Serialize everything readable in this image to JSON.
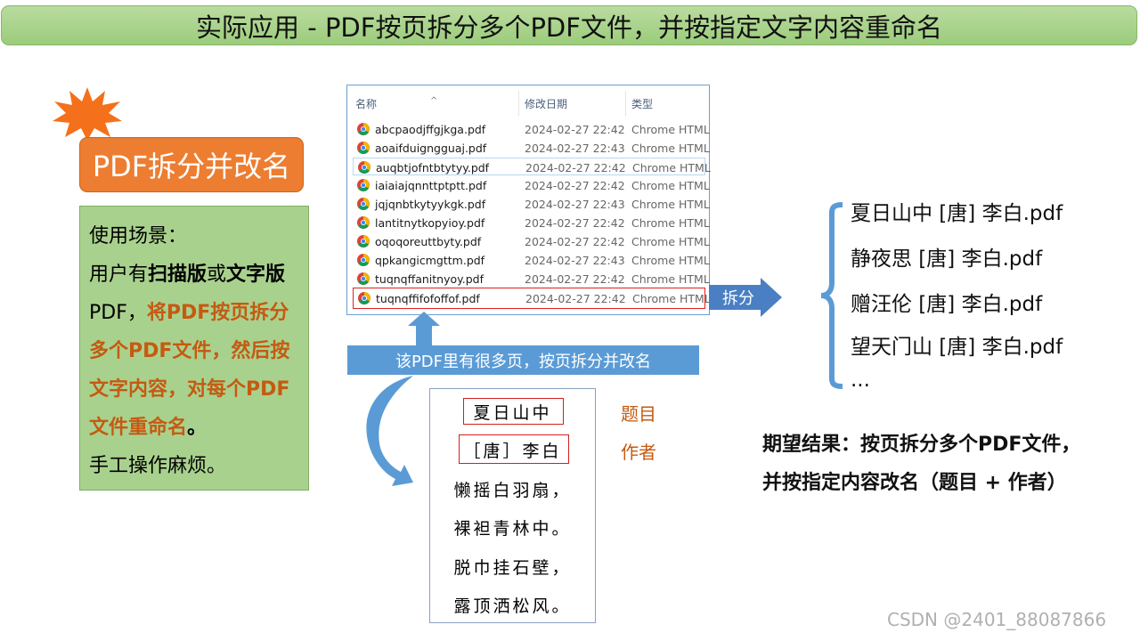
{
  "title": "实际应用 - PDF按页拆分多个PDF文件，并按指定文字内容重命名",
  "badge": "PDF拆分并改名",
  "scenario": {
    "p1": "使用场景：",
    "p2a": "用户有",
    "p2b": "扫描版",
    "p2c": "或",
    "p2d": "文字版",
    "p2e": "PDF，",
    "p2f": "将PDF按页拆分多个PDF文件，然后按文字内容，对每个PDF文件重命名",
    "p2g": "。",
    "p3": "手工操作麻烦。"
  },
  "explorer": {
    "col_name": "名称",
    "col_date": "修改日期",
    "col_type": "类型",
    "sort_icon": "sort-up-caret",
    "files": [
      {
        "name": "abcpaodjffgjkga.pdf",
        "date": "2024-02-27 22:42",
        "type": "Chrome HTML"
      },
      {
        "name": "aoaifduigngguaj.pdf",
        "date": "2024-02-27 22:43",
        "type": "Chrome HTML"
      },
      {
        "name": "auqbtjofntbtytyy.pdf",
        "date": "2024-02-27 22:42",
        "type": "Chrome HTML"
      },
      {
        "name": "iaiaiajqnnttptptt.pdf",
        "date": "2024-02-27 22:42",
        "type": "Chrome HTML"
      },
      {
        "name": "jqjqnbtkytyykgk.pdf",
        "date": "2024-02-27 22:43",
        "type": "Chrome HTML"
      },
      {
        "name": "lantitnytkopyioy.pdf",
        "date": "2024-02-27 22:42",
        "type": "Chrome HTML"
      },
      {
        "name": "oqoqoreuttbyty.pdf",
        "date": "2024-02-27 22:42",
        "type": "Chrome HTML"
      },
      {
        "name": "qpkangicmgttm.pdf",
        "date": "2024-02-27 22:43",
        "type": "Chrome HTML"
      },
      {
        "name": "tuqnqffanitnyoy.pdf",
        "date": "2024-02-27 22:42",
        "type": "Chrome HTML"
      },
      {
        "name": "tuqnqffifofoffof.pdf",
        "date": "2024-02-27 22:42",
        "type": "Chrome HTML"
      }
    ]
  },
  "split_label": "拆分",
  "description": "该PDF里有很多页，按页拆分并改名",
  "poem": {
    "title": "夏日山中",
    "author": "［唐］李白",
    "lines": [
      "懒摇白羽扇，",
      "裸袒青林中。",
      "脱巾挂石壁，",
      "露顶洒松风。"
    ]
  },
  "labels": {
    "title_label": "题目",
    "author_label": "作者"
  },
  "outputs": [
    "夏日山中 [唐] 李白.pdf",
    "静夜思 [唐] 李白.pdf",
    "赠汪伦 [唐] 李白.pdf",
    "望天门山 [唐] 李白.pdf",
    "..."
  ],
  "expect": {
    "line1": "期望结果：按页拆分多个PDF文件，",
    "line2": "并按指定内容改名（题目 + 作者）"
  },
  "watermark": "CSDN @2401_88087866",
  "colors": {
    "orange": "#ed7d31",
    "green": "#a9d18e",
    "blue": "#5b9bd5",
    "red": "#e02020"
  }
}
